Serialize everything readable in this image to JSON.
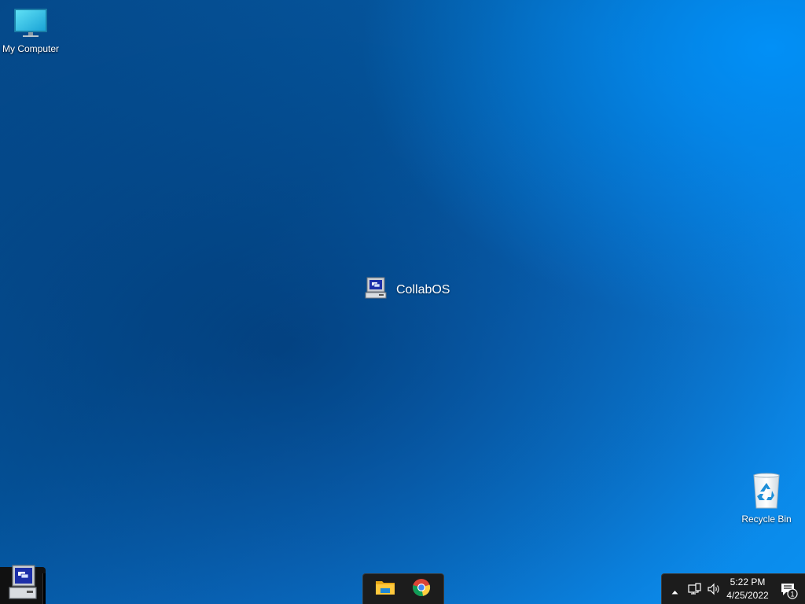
{
  "desktop": {
    "icons": [
      {
        "label": "My Computer",
        "icon": "monitor-icon"
      },
      {
        "label": "Recycle Bin",
        "icon": "recycle-bin-icon"
      }
    ],
    "logo": {
      "text": "CollabOS",
      "icon": "collabos-computer-icon"
    }
  },
  "taskbar": {
    "start": {
      "icon": "collabos-computer-icon"
    },
    "pinned": [
      {
        "icon": "file-explorer-icon"
      },
      {
        "icon": "chrome-icon"
      }
    ],
    "tray": {
      "icons": [
        "chevron-up-icon",
        "network-icon",
        "volume-icon"
      ],
      "time": "5:22 PM",
      "date": "4/25/2022",
      "notifications": {
        "icon": "notification-icon",
        "count": "1"
      }
    }
  },
  "colors": {
    "wallpaper_dark": "#05498a",
    "wallpaper_light": "#0a90f0",
    "taskbar": "#1c1c1c"
  }
}
